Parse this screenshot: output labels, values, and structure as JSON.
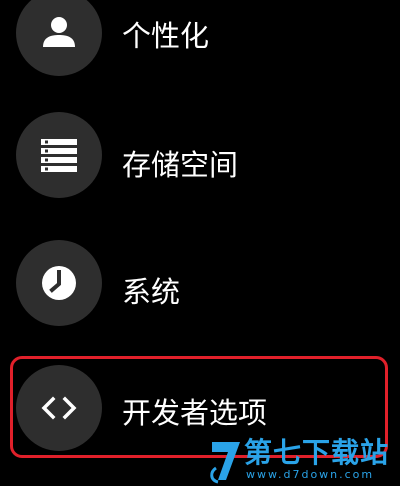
{
  "menu": {
    "items": [
      {
        "label": "个性化",
        "icon": "person-icon"
      },
      {
        "label": "存储空间",
        "icon": "storage-list-icon"
      },
      {
        "label": "系统",
        "icon": "clock-icon"
      },
      {
        "label": "开发者选项",
        "icon": "code-brackets-icon",
        "highlighted": true
      }
    ]
  },
  "colors": {
    "background": "#000000",
    "icon_circle": "#2e2e2e",
    "text": "#ffffff",
    "highlight": "#e0202a",
    "watermark": "#2aa3e8"
  },
  "watermark": {
    "title": "第七下载站",
    "url": "www.d7down.com"
  }
}
